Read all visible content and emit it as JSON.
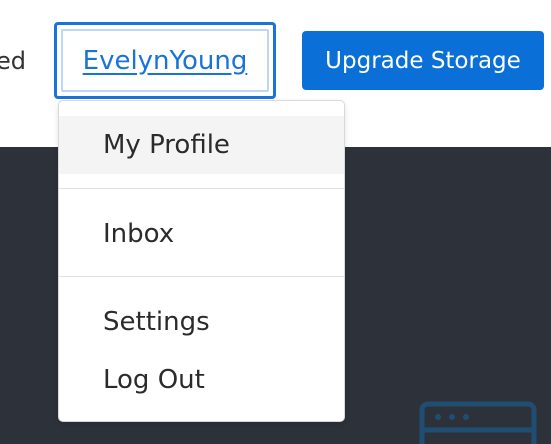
{
  "header": {
    "trailing_text": "ed",
    "user_button_label": "EvelynYoung",
    "upgrade_label": "Upgrade Storage"
  },
  "menu": {
    "items": [
      {
        "label": "My Profile",
        "highlighted": true
      },
      {
        "label": "Inbox",
        "highlighted": false
      },
      {
        "label": "Settings",
        "highlighted": false
      },
      {
        "label": "Log Out",
        "highlighted": false
      }
    ]
  },
  "icons": {
    "background_icon": "server-icon"
  },
  "colors": {
    "accent": "#1a73d9",
    "button_bg": "#0b6fd8",
    "dark_background": "#2c313a",
    "menu_highlight": "#f4f4f4",
    "icon_color": "#1f4e72"
  }
}
